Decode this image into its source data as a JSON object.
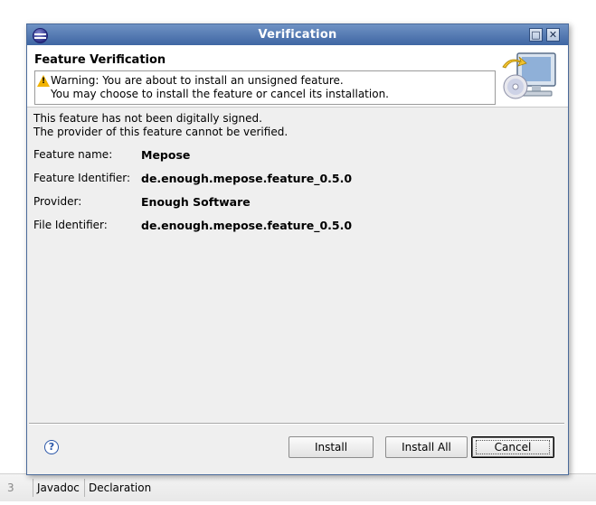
{
  "background_tabs": {
    "first": "3",
    "javadoc": "Javadoc",
    "declaration": "Declaration"
  },
  "dialog": {
    "title": "Verification",
    "banner": {
      "heading": "Feature Verification",
      "warning_line1": "Warning: You are about to install an unsigned feature.",
      "warning_line2": "You may choose to install the feature or cancel its installation."
    },
    "messages": [
      "This feature has not been digitally signed.",
      "The provider of this feature cannot be verified."
    ],
    "fields": [
      {
        "label": "Feature name:",
        "value": "Mepose"
      },
      {
        "label": "Feature Identifier:",
        "value": "de.enough.mepose.feature_0.5.0"
      },
      {
        "label": "Provider:",
        "value": "Enough Software"
      },
      {
        "label": "File Identifier:",
        "value": "de.enough.mepose.feature_0.5.0"
      }
    ],
    "buttons": {
      "help": "?",
      "install": "Install",
      "install_all": "Install All",
      "cancel": "Cancel"
    }
  },
  "icons": [
    "eclipse-icon",
    "maximize-icon",
    "close-icon",
    "warning-icon",
    "install-wizard-graphic",
    "help-icon"
  ]
}
